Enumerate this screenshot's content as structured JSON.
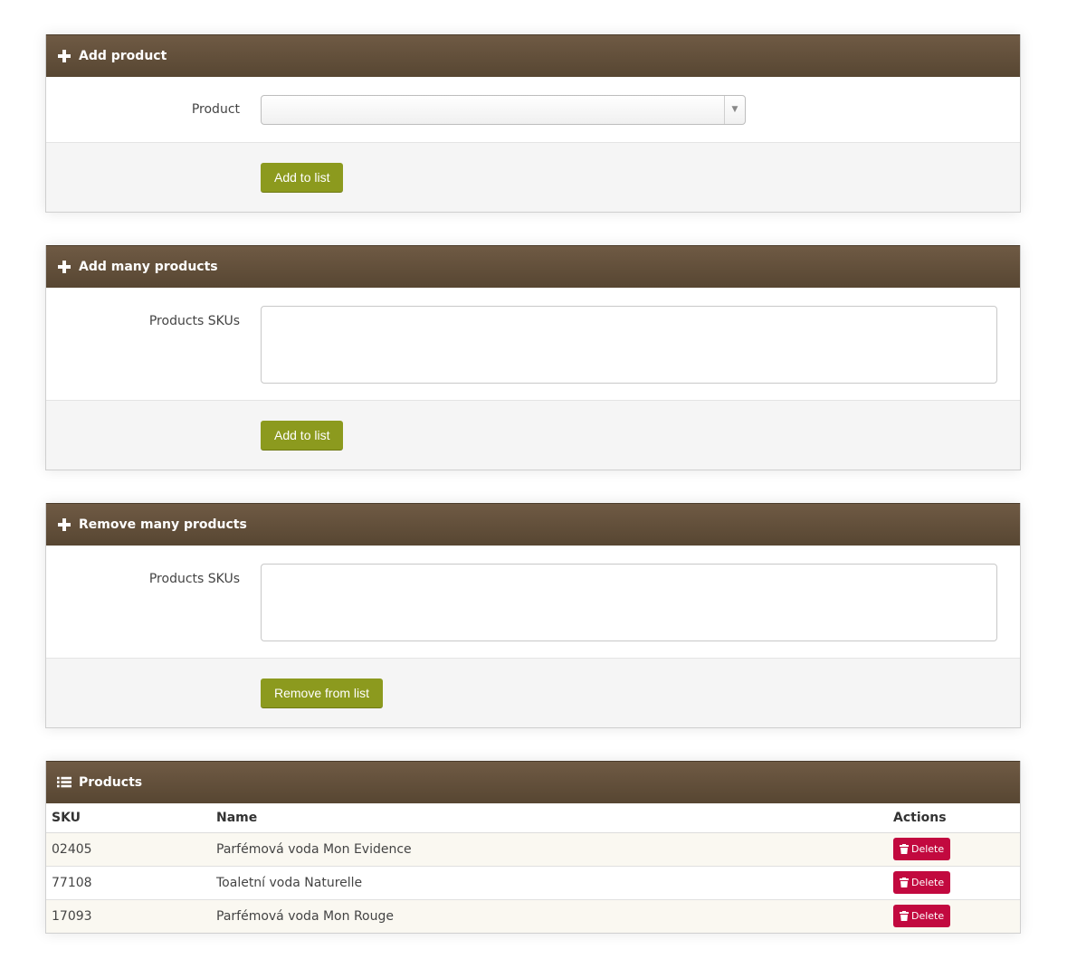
{
  "add_product": {
    "title": "Add product",
    "product_label": "Product",
    "product_value": "",
    "button": "Add to list"
  },
  "add_many": {
    "title": "Add many products",
    "skus_label": "Products SKUs",
    "button": "Add to list"
  },
  "remove_many": {
    "title": "Remove many products",
    "skus_label": "Products SKUs",
    "button": "Remove from list"
  },
  "products": {
    "title": "Products",
    "columns": {
      "sku": "SKU",
      "name": "Name",
      "actions": "Actions"
    },
    "rows": [
      {
        "sku": "02405",
        "name": "Parfémová voda Mon Evidence",
        "action": "Delete"
      },
      {
        "sku": "77108",
        "name": "Toaletní voda Naturelle",
        "action": "Delete"
      },
      {
        "sku": "17093",
        "name": "Parfémová voda Mon Rouge",
        "action": "Delete"
      }
    ]
  },
  "colors": {
    "header": "#5f4d39",
    "button": "#8c9a1e",
    "delete": "#c2093f"
  }
}
